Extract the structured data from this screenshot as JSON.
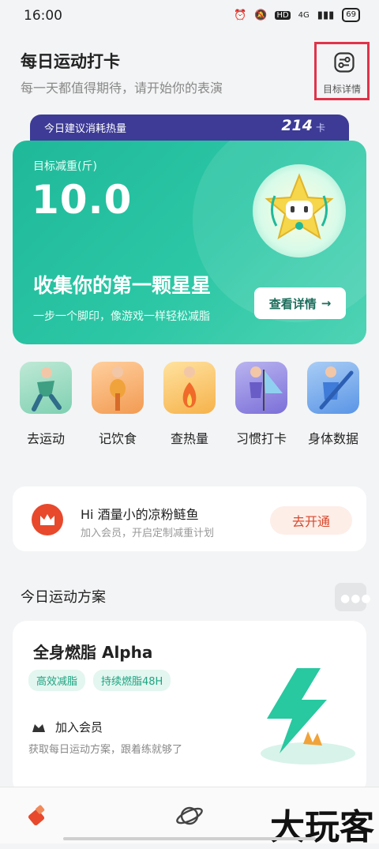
{
  "status": {
    "time": "16:00",
    "hd": "HD",
    "network": "4G",
    "battery": "69"
  },
  "header": {
    "title": "每日运动打卡",
    "subtitle": "每一天都值得期待，请开始你的表演",
    "goal_label": "目标详情"
  },
  "calorie": {
    "label": "今日建议消耗热量",
    "value": "214",
    "unit": "卡"
  },
  "hero": {
    "subtitle": "目标减重(斤)",
    "value": "10.0",
    "title": "收集你的第一颗星星",
    "desc": "一步一个脚印，像游戏一样轻松减脂",
    "button": "查看详情",
    "button_arrow": "→"
  },
  "shortcuts": [
    {
      "label": "去运动"
    },
    {
      "label": "记饮食"
    },
    {
      "label": "查热量"
    },
    {
      "label": "习惯打卡"
    },
    {
      "label": "身体数据"
    }
  ],
  "member": {
    "title": "Hi 酒量小的凉粉鲢鱼",
    "subtitle": "加入会员，开启定制减重计划",
    "button": "去开通"
  },
  "plan_section": {
    "title": "今日运动方案"
  },
  "plan": {
    "title": "全身燃脂 Alpha",
    "tags": [
      "高效减脂",
      "持续燃脂48H"
    ],
    "vip_title": "加入会员",
    "desc": "获取每日运动方案，跟着练就够了"
  },
  "watermark": "大玩客",
  "colors": {
    "accent": "#2cc7a5",
    "calorie_bar": "#3d3b96",
    "member_red": "#e8482c"
  }
}
